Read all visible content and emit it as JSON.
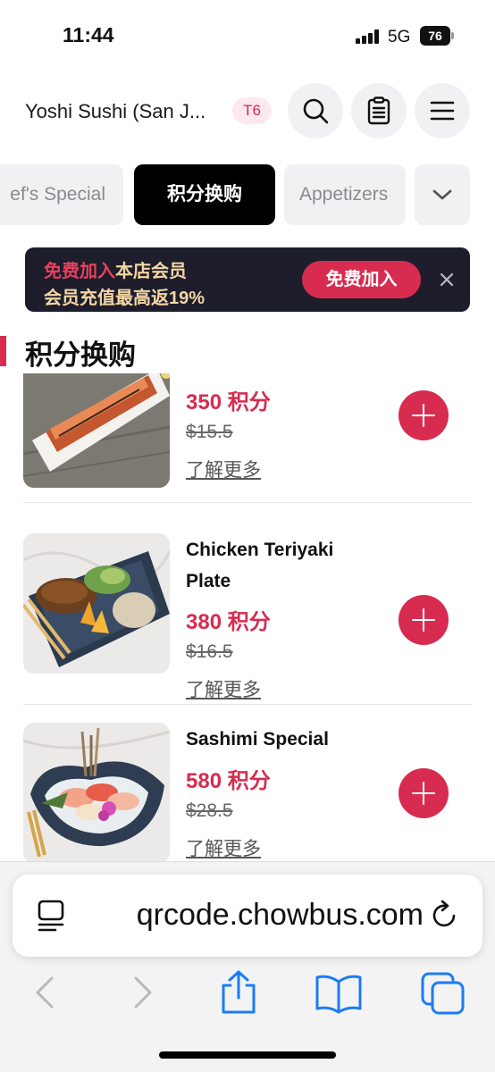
{
  "status_bar": {
    "time": "11:44",
    "network": "5G",
    "battery": "76"
  },
  "header": {
    "store_name": "Yoshi Sushi (San J...",
    "table_badge": "T6"
  },
  "tabs": [
    {
      "label": "ef's Special",
      "active": false
    },
    {
      "label": "积分换购",
      "active": true
    },
    {
      "label": "Appetizers",
      "active": false
    }
  ],
  "banner": {
    "highlight": "免费加入",
    "line1_rest": "本店会员",
    "line2": "会员充值最高返19%",
    "button_label": "免费加入"
  },
  "section": {
    "title": "积分换购"
  },
  "items": [
    {
      "name": "",
      "points": "350 积分",
      "price": "$15.5",
      "more_label": "了解更多"
    },
    {
      "name": "Chicken Teriyaki Plate",
      "points": "380 积分",
      "price": "$16.5",
      "more_label": "了解更多"
    },
    {
      "name": "Sashimi Special",
      "points": "580 积分",
      "price": "$28.5",
      "more_label": "了解更多"
    }
  ],
  "browser": {
    "url": "qrcode.chowbus.com"
  },
  "colors": {
    "accent": "#d72c50",
    "banner_bg": "#1d1d2b",
    "banner_text": "#f3d6a4",
    "active_tab": "#000000",
    "ios_blue": "#1a7cf5"
  }
}
